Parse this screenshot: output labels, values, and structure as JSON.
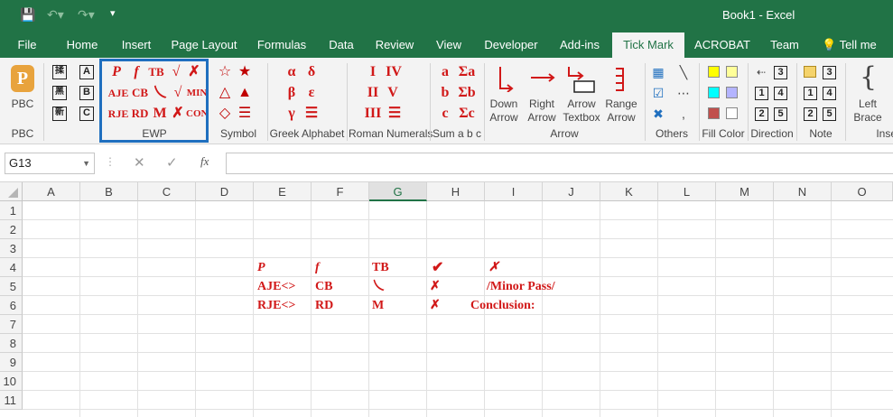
{
  "titlebar": {
    "title": "Book1  -  Excel"
  },
  "tabs": [
    "File",
    "Home",
    "Insert",
    "Page Layout",
    "Formulas",
    "Data",
    "Review",
    "View",
    "Developer",
    "Add-ins",
    "Tick Mark",
    "ACROBAT",
    "Team",
    "Tell me wha"
  ],
  "ribbon": {
    "pbc": {
      "button": "PBC",
      "label": "PBC"
    },
    "ewp": {
      "label": "EWP",
      "row1": [
        "P",
        "f",
        "TB",
        "√",
        "✗",
        "MIN"
      ],
      "row2": [
        "AJE",
        "CB",
        "乀",
        "√",
        "✗"
      ],
      "row3": [
        "RJE",
        "RD",
        "M",
        "✗",
        "CON"
      ]
    },
    "symbol": {
      "label": "Symbol",
      "glyphs": [
        "☆",
        "★",
        "△",
        "▲",
        "◇",
        "☰"
      ]
    },
    "greek": {
      "label": "Greek Alphabet",
      "glyphs": [
        "α",
        "δ",
        "β",
        "ε",
        "γ",
        "☰"
      ]
    },
    "roman": {
      "label": "Roman Numerals",
      "glyphs": [
        "I",
        "IV",
        "II",
        "V",
        "III",
        "☰"
      ]
    },
    "sum": {
      "label": "Sum a b c",
      "glyphs": [
        "a",
        "Σa",
        "b",
        "Σb",
        "c",
        "Σc"
      ]
    },
    "arrow": {
      "label": "Arrow",
      "buttons": [
        {
          "l1": "Down",
          "l2": "Arrow"
        },
        {
          "l1": "Right",
          "l2": "Arrow"
        },
        {
          "l1": "Arrow",
          "l2": "Textbox"
        },
        {
          "l1": "Range",
          "l2": "Arrow"
        }
      ]
    },
    "others": {
      "label": "Others"
    },
    "fillcolor": {
      "label": "Fill Color",
      "colors": [
        "#ffff00",
        "#ffff99",
        "#00ffff",
        "#b4b4ff",
        "#c0504d",
        "#ffffff"
      ]
    },
    "direction": {
      "label": "Direction",
      "nums": [
        "3",
        "4",
        "5"
      ]
    },
    "note": {
      "label": "Note",
      "nums": [
        "3",
        "4",
        "5"
      ]
    },
    "insert": {
      "label": "Inse",
      "button_l1": "Left",
      "button_l2": "Brace"
    }
  },
  "formula_bar": {
    "name_box": "G13",
    "fx": "fx"
  },
  "columns": [
    "A",
    "B",
    "C",
    "D",
    "E",
    "F",
    "G",
    "H",
    "I",
    "J",
    "K",
    "L",
    "M",
    "N",
    "O"
  ],
  "rows": [
    "1",
    "2",
    "3",
    "4",
    "5",
    "6",
    "7",
    "8",
    "9",
    "10",
    "11"
  ],
  "cells": {
    "E4": "P",
    "F4": "f",
    "G4": "TB",
    "H4": "✔",
    "I4": "✗",
    "E5": "AJE<>",
    "F5": "CB",
    "G5": "乀",
    "H5": "✗",
    "I5": "/Minor Pass/",
    "E6": "RJE<>",
    "F6": "RD",
    "G6": "M",
    "H6": "✗",
    "I6": "Conclusion:"
  }
}
